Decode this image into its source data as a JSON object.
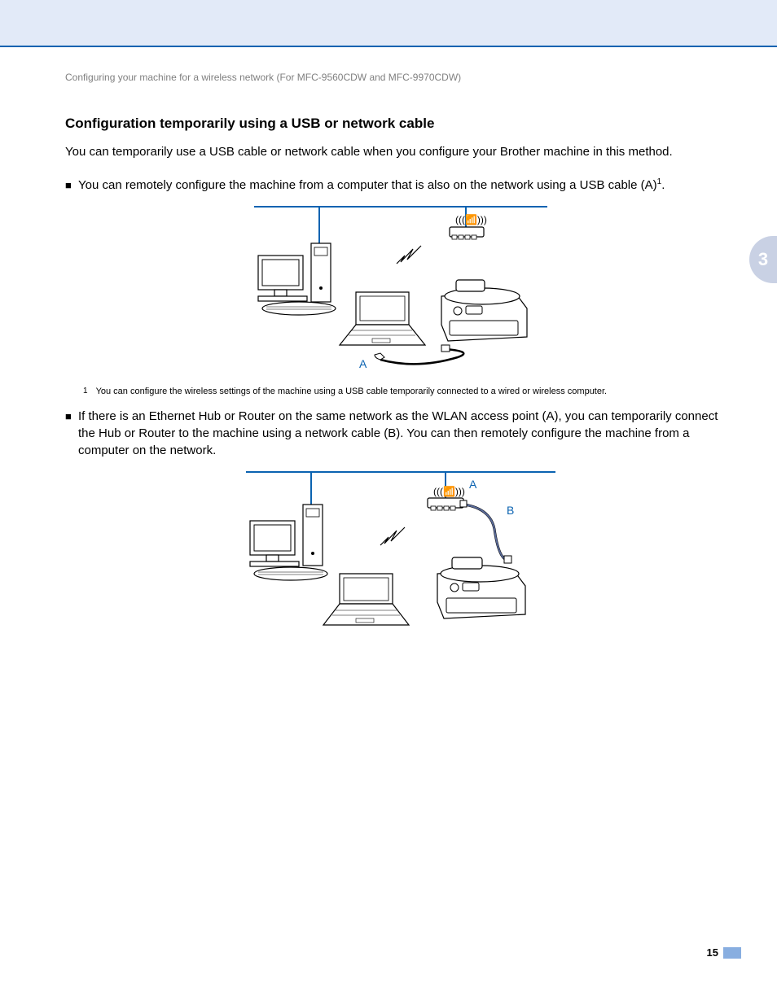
{
  "header": {
    "running_head": "Configuring your machine for a wireless network (For MFC-9560CDW and MFC-9970CDW)"
  },
  "section": {
    "title": "Configuration temporarily using a USB or network cable",
    "intro": "You can temporarily use a USB cable or network cable when you configure your Brother machine in this method.",
    "bullet1": "You can remotely configure the machine from a computer that is also on the network using a USB cable (A)",
    "bullet1_sup": "1",
    "bullet1_end": ".",
    "footnote_num": "1",
    "footnote_text": "You can configure the wireless settings of the machine using a USB cable temporarily connected to a wired or wireless computer.",
    "bullet2": "If there is an Ethernet Hub or Router on the same network as the WLAN access point (A), you can temporarily connect the Hub or Router to the machine using a network cable (B). You can then remotely configure the machine from a computer on the network."
  },
  "figure1": {
    "label_a": "A"
  },
  "figure2": {
    "label_a": "A",
    "label_b": "B"
  },
  "side_tab": {
    "chapter": "3"
  },
  "footer": {
    "page_number": "15"
  }
}
